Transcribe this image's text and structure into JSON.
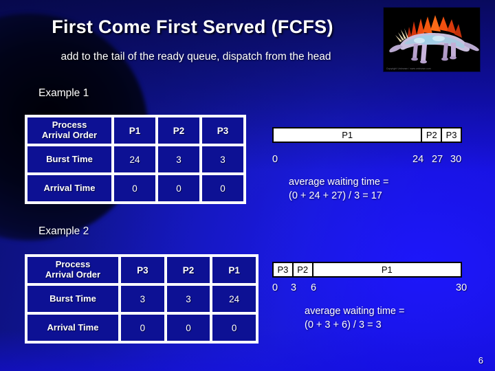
{
  "slide": {
    "title": "First Come First Served (FCFS)",
    "subtitle": "add to the tail of the ready queue, dispatch from the head",
    "page_number": "6",
    "background_color": "#0a0d8c",
    "accent_color": "#1a1fd0"
  },
  "image": {
    "name": "stegosaurus-illustration",
    "credit": "Copyright Unknown / www.unknown.com"
  },
  "example1": {
    "label": "Example 1",
    "table": {
      "row_headers": [
        "Process\nArrival Order",
        "Burst Time",
        "Arrival Time"
      ],
      "header_line1": "Process",
      "header_line2": "Arrival Order",
      "burst_label": "Burst Time",
      "arrival_label": "Arrival Time",
      "processes": [
        "P1",
        "P2",
        "P3"
      ],
      "burst_times": [
        "24",
        "3",
        "3"
      ],
      "arrival_times": [
        "0",
        "0",
        "0"
      ]
    },
    "gantt": {
      "segments": [
        {
          "label": "P1",
          "start": 0,
          "end": 24
        },
        {
          "label": "P2",
          "start": 24,
          "end": 27
        },
        {
          "label": "P3",
          "start": 27,
          "end": 30
        }
      ],
      "ticks": [
        "0",
        "24",
        "27",
        "30"
      ]
    },
    "average_waiting": "average waiting time =\n(0 + 24 + 27) / 3 = 17"
  },
  "example2": {
    "label": "Example 2",
    "table": {
      "header_line1": "Process",
      "header_line2": "Arrival Order",
      "burst_label": "Burst Time",
      "arrival_label": "Arrival Time",
      "processes": [
        "P3",
        "P2",
        "P1"
      ],
      "burst_times": [
        "3",
        "3",
        "24"
      ],
      "arrival_times": [
        "0",
        "0",
        "0"
      ]
    },
    "gantt": {
      "segments": [
        {
          "label": "P3",
          "start": 0,
          "end": 3
        },
        {
          "label": "P2",
          "start": 3,
          "end": 6
        },
        {
          "label": "P1",
          "start": 6,
          "end": 30
        }
      ],
      "ticks": [
        "0",
        "3",
        "6",
        "30"
      ]
    },
    "average_waiting": "average waiting time =\n(0 + 3 + 6) / 3 = 3"
  }
}
